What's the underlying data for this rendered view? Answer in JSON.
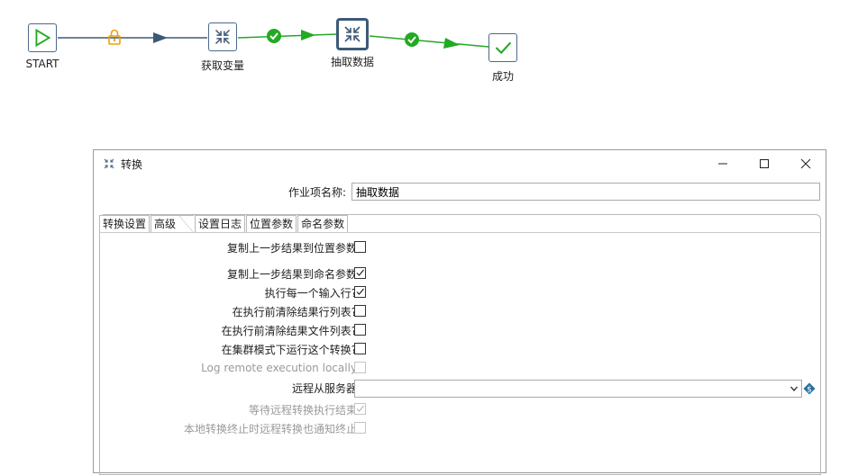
{
  "canvas": {
    "nodes": [
      {
        "id": "start",
        "label": "START"
      },
      {
        "id": "get_vars",
        "label": "获取变量"
      },
      {
        "id": "extract",
        "label": "抽取数据"
      },
      {
        "id": "success",
        "label": "成功"
      }
    ]
  },
  "dialog": {
    "title": "转换",
    "job_name_label": "作业项名称:",
    "job_name_value": "抽取数据",
    "tabs": [
      "转换设置",
      "高级",
      "设置日志",
      "位置参数",
      "命名参数"
    ],
    "active_tab": "高级",
    "options": [
      {
        "label": "复制上一步结果到位置参数",
        "checked": false,
        "disabled": false
      },
      {
        "label": "复制上一步结果到命名参数",
        "checked": true,
        "disabled": false
      },
      {
        "label": "执行每一个输入行?",
        "checked": true,
        "disabled": false
      },
      {
        "label": "在执行前清除结果行列表?",
        "checked": false,
        "disabled": false
      },
      {
        "label": "在执行前清除结果文件列表?",
        "checked": false,
        "disabled": false
      },
      {
        "label": "在集群模式下运行这个转换?",
        "checked": false,
        "disabled": false
      },
      {
        "label": "Log remote execution locally",
        "checked": false,
        "disabled": true
      }
    ],
    "remote_slave_label": "远程从服务器",
    "remote_slave_value": "",
    "options2": [
      {
        "label": "等待远程转换执行结束",
        "checked": true,
        "disabled": true
      },
      {
        "label": "本地转换终止时远程转换也通知终止",
        "checked": false,
        "disabled": true
      }
    ]
  },
  "colors": {
    "hop_ok": "#22aa22",
    "hop_lock": "#3c5a78",
    "lock": "#f0a000"
  }
}
